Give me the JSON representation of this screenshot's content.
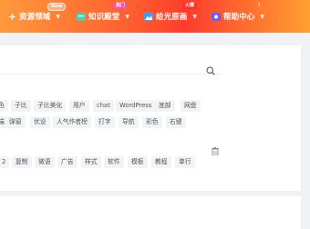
{
  "nav": {
    "items": [
      {
        "label": "资源领域",
        "icon": "sparkle-icon",
        "badge": "New",
        "badge_style": "new"
      },
      {
        "label": "知识殿堂",
        "icon": "book-icon",
        "badge": "热门",
        "badge_style": "pink"
      },
      {
        "label": "给光原画",
        "icon": "image-icon",
        "badge": "火爆",
        "badge_style": "red"
      },
      {
        "label": "帮助中心",
        "icon": "help-icon",
        "badge": "!",
        "badge_style": "orange"
      }
    ]
  },
  "search": {
    "value": "",
    "placeholder": ""
  },
  "tags_row1": [
    "色",
    "子比",
    "子比美化",
    "用户",
    "chat",
    "WordPress",
    "底部",
    "网盘"
  ],
  "tags_row2": [
    "端",
    "弹窗",
    "优设",
    "人气作者榜",
    "打字",
    "导航",
    "彩色",
    "右键"
  ],
  "tags_row3": [
    "2",
    "复制",
    "微语",
    "广告",
    "样式",
    "软件",
    "模板",
    "教程",
    "单行"
  ],
  "colors": {
    "accent": "#ff5a2e",
    "tag_bg": "#f2f3f5"
  }
}
